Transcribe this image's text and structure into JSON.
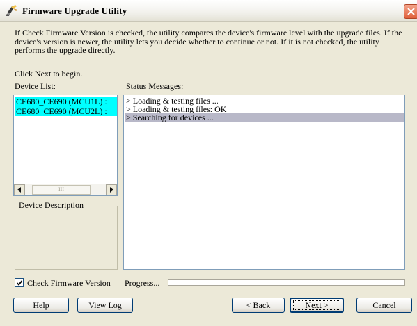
{
  "window": {
    "title": "Firmware Upgrade Utility",
    "close_icon": "close-icon",
    "app_icon": "firmware-upgrade-icon"
  },
  "description": "If Check Firmware Version is checked, the utility compares the device's firmware level with the upgrade files. If the device's version is newer, the utility lets you decide whether to continue or not. If it is not checked, the utility performs the upgrade directly.",
  "instruction": "Click Next to begin.",
  "device_list": {
    "label": "Device List:",
    "items": [
      "CE680_CE690 (MCU1L) :",
      "CE680_CE690 (MCU2L) :"
    ],
    "scroll_thumb": "III"
  },
  "device_description": {
    "title": "Device Description"
  },
  "status": {
    "label": "Status Messages:",
    "messages": [
      "> Loading & testing files ...",
      "> Loading & testing files: OK",
      "> Searching for devices ..."
    ]
  },
  "check_firmware": {
    "label": "Check Firmware Version",
    "checked": true
  },
  "progress": {
    "label": "Progress...",
    "value": 0
  },
  "buttons": {
    "help": "Help",
    "view_log": "View Log",
    "back": "< Back",
    "next": "Next >",
    "cancel": "Cancel"
  }
}
